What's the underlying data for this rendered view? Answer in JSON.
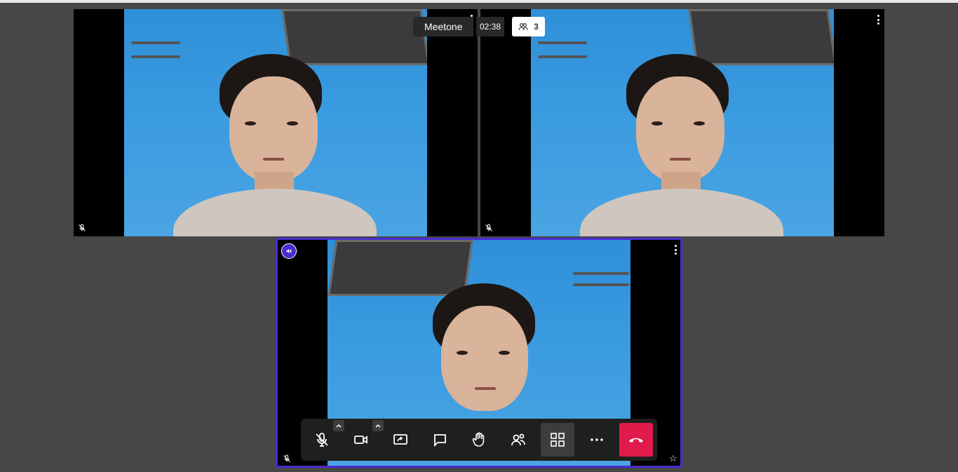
{
  "meeting": {
    "name": "Meetone",
    "timer": "02:38",
    "participant_count": "3"
  },
  "tiles": [
    {
      "name": "remote-participant-1",
      "mic_muted": true
    },
    {
      "name": "remote-participant-2",
      "mic_muted": true
    },
    {
      "name": "local-participant",
      "mic_muted": true,
      "moderator": true,
      "dominant_speaker": true
    }
  ],
  "toolbar": {
    "buttons": [
      "microphone",
      "camera",
      "share-screen",
      "chat",
      "raise-hand",
      "participants",
      "tile-view",
      "more-actions",
      "leave-call"
    ],
    "active": "tile-view"
  },
  "colors": {
    "background": "#474747",
    "accent": "#4b2bd0",
    "hangup": "#e01b4c",
    "toolbar": "#1f1f1f"
  }
}
